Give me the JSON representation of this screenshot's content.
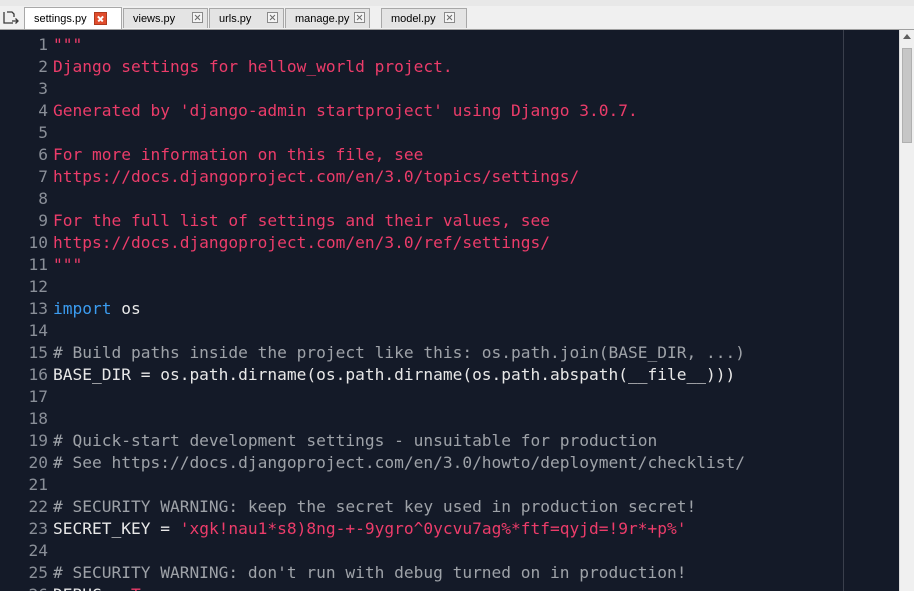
{
  "tabs": [
    {
      "label": "settings.py",
      "active": true
    },
    {
      "label": "views.py",
      "active": false
    },
    {
      "label": "urls.py",
      "active": false
    },
    {
      "label": "manage.py",
      "active": false
    },
    {
      "label": "model.py",
      "active": false
    }
  ],
  "editor": {
    "lines": [
      {
        "n": "1",
        "tokens": [
          {
            "t": "\"\"\"",
            "c": "str"
          }
        ]
      },
      {
        "n": "2",
        "tokens": [
          {
            "t": "Django settings for hellow_world project.",
            "c": "str"
          }
        ]
      },
      {
        "n": "3",
        "tokens": []
      },
      {
        "n": "4",
        "tokens": [
          {
            "t": "Generated by 'django-admin startproject' using Django 3.0.7.",
            "c": "str"
          }
        ]
      },
      {
        "n": "5",
        "tokens": []
      },
      {
        "n": "6",
        "tokens": [
          {
            "t": "For more information on this file, see",
            "c": "str"
          }
        ]
      },
      {
        "n": "7",
        "tokens": [
          {
            "t": "https://docs.djangoproject.com/en/3.0/topics/settings/",
            "c": "str"
          }
        ]
      },
      {
        "n": "8",
        "tokens": []
      },
      {
        "n": "9",
        "tokens": [
          {
            "t": "For the full list of settings and their values, see",
            "c": "str"
          }
        ]
      },
      {
        "n": "10",
        "tokens": [
          {
            "t": "https://docs.djangoproject.com/en/3.0/ref/settings/",
            "c": "str"
          }
        ]
      },
      {
        "n": "11",
        "tokens": [
          {
            "t": "\"\"\"",
            "c": "str"
          }
        ]
      },
      {
        "n": "12",
        "tokens": []
      },
      {
        "n": "13",
        "tokens": [
          {
            "t": "import",
            "c": "kw"
          },
          {
            "t": " os",
            "c": "txt"
          }
        ]
      },
      {
        "n": "14",
        "tokens": []
      },
      {
        "n": "15",
        "tokens": [
          {
            "t": "# Build paths inside the project like this: os.path.join(BASE_DIR, ...)",
            "c": "com"
          }
        ]
      },
      {
        "n": "16",
        "tokens": [
          {
            "t": "BASE_DIR = os.path.dirname(os.path.dirname(os.path.abspath(__file__)))",
            "c": "txt"
          }
        ]
      },
      {
        "n": "17",
        "tokens": []
      },
      {
        "n": "18",
        "tokens": []
      },
      {
        "n": "19",
        "tokens": [
          {
            "t": "# Quick-start development settings - unsuitable for production",
            "c": "com"
          }
        ]
      },
      {
        "n": "20",
        "tokens": [
          {
            "t": "# See https://docs.djangoproject.com/en/3.0/howto/deployment/checklist/",
            "c": "com"
          }
        ]
      },
      {
        "n": "21",
        "tokens": []
      },
      {
        "n": "22",
        "tokens": [
          {
            "t": "# SECURITY WARNING: keep the secret key used in production secret!",
            "c": "com"
          }
        ]
      },
      {
        "n": "23",
        "tokens": [
          {
            "t": "SECRET_KEY = ",
            "c": "txt"
          },
          {
            "t": "'xgk!nau1*s8)8ng-+-9ygro^0ycvu7ag%*ftf=qyjd=!9r*+p%'",
            "c": "str"
          }
        ]
      },
      {
        "n": "24",
        "tokens": []
      },
      {
        "n": "25",
        "tokens": [
          {
            "t": "# SECURITY WARNING: don't run with debug turned on in production!",
            "c": "com"
          }
        ]
      },
      {
        "n": "26",
        "tokens": [
          {
            "t": "DEBUG = ",
            "c": "txt"
          },
          {
            "t": "True",
            "c": "str"
          }
        ]
      }
    ]
  },
  "colors": {
    "background": "#141a28",
    "string": "#ec3c6a",
    "comment": "#9ea2a8",
    "keyword": "#3b9cf0",
    "text": "#e8e8e8",
    "line_number": "#8a8f98",
    "active_tab_close": "#e04c2c"
  },
  "icons": {
    "new_tab": "new-tab-icon",
    "close_tab": "close-icon",
    "scroll_up": "arrow-up-icon"
  }
}
